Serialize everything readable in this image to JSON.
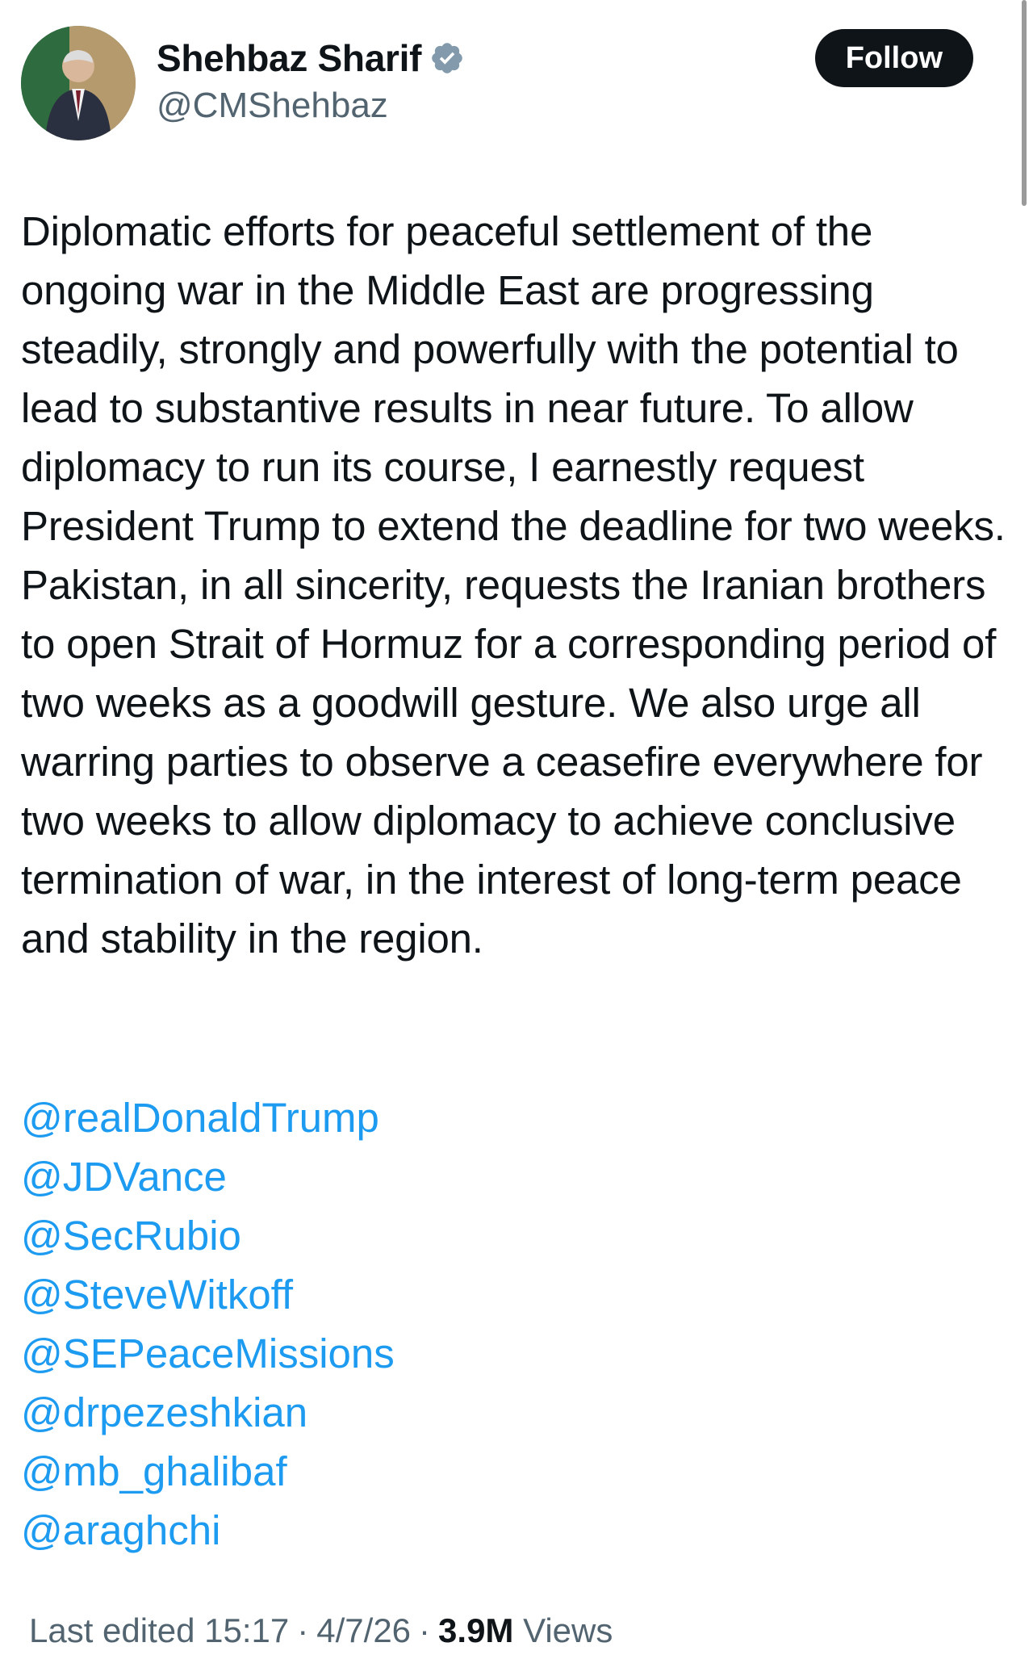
{
  "author": {
    "display_name": "Shehbaz Sharif",
    "handle": "@CMShehbaz",
    "verified_icon": "verified-badge-icon",
    "avatar_icon": "profile-photo"
  },
  "follow_label": "Follow",
  "tweet_text": "Diplomatic efforts for peaceful settlement of the ongoing war in the Middle East are progressing steadily, strongly and powerfully with the potential to lead to substantive results in near future. To allow diplomacy to run its course, I earnestly request President Trump to extend the deadline for two weeks. Pakistan, in all sincerity, requests the Iranian brothers to open Strait of Hormuz for a corresponding period of two weeks as a goodwill gesture. We also urge all warring parties to observe a ceasefire everywhere for two weeks to allow diplomacy to achieve conclusive termination of war, in the interest of long-term peace and stability in the region.",
  "mentions": [
    "@realDonaldTrump",
    "@JDVance",
    "@SecRubio",
    "@SteveWitkoff",
    "@SEPeaceMissions",
    "@drpezeshkian",
    "@mb_ghalibaf",
    "@araghchi"
  ],
  "meta": {
    "edited_label": "Last edited 15:17",
    "separator": "·",
    "date": "4/7/26",
    "views_count": "3.9M",
    "views_label": "Views"
  },
  "colors": {
    "link": "#1d9bf0",
    "text": "#0f1419",
    "secondary": "#536471",
    "button_bg": "#0f1419",
    "verified": "#829aab"
  }
}
